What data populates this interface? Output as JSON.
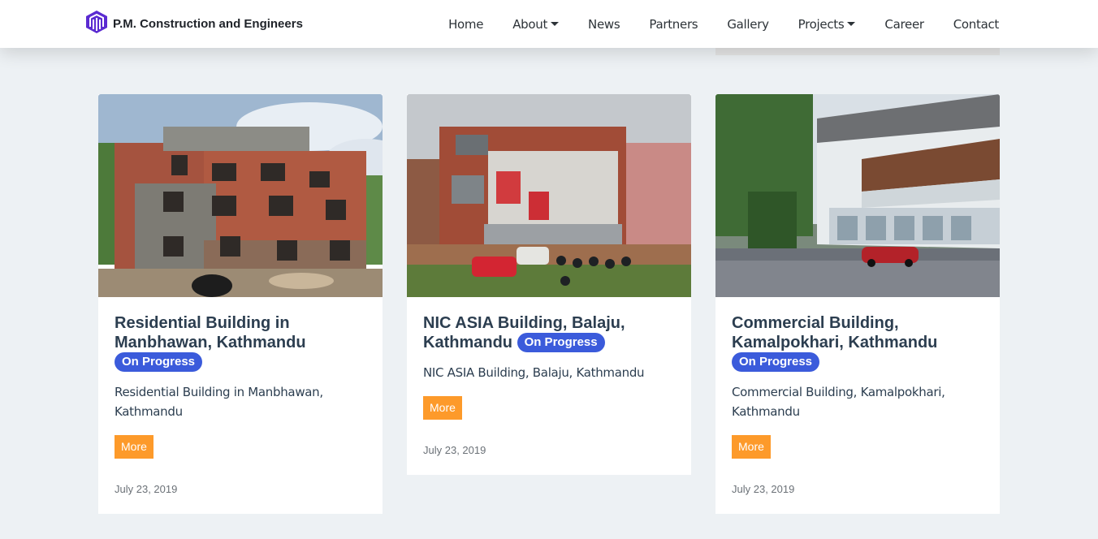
{
  "header": {
    "brand_name": "P.M. Construction and Engineers",
    "nav": [
      {
        "label": "Home",
        "dropdown": false
      },
      {
        "label": "About",
        "dropdown": true
      },
      {
        "label": "News",
        "dropdown": false
      },
      {
        "label": "Partners",
        "dropdown": false
      },
      {
        "label": "Gallery",
        "dropdown": false
      },
      {
        "label": "Projects",
        "dropdown": true
      },
      {
        "label": "Career",
        "dropdown": false
      },
      {
        "label": "Contact",
        "dropdown": false
      }
    ]
  },
  "colors": {
    "accent": "#3b5bdb",
    "button": "#fd9a2a",
    "brand_icon": "#5b2bd1",
    "background": "#edf1f4"
  },
  "projects": [
    {
      "title": "Residential Building in Manbhawan, Kathmandu",
      "status": "On Progress",
      "description": "Residential Building in Manbhawan, Kathmandu",
      "button": "More",
      "date": "July 23, 2019"
    },
    {
      "title": "NIC ASIA Building, Balaju, Kathmandu",
      "status": "On Progress",
      "description": "NIC ASIA Building, Balaju, Kathmandu",
      "button": "More",
      "date": "July 23, 2019"
    },
    {
      "title": "Commercial Building, Kamalpokhari, Kathmandu",
      "status": "On Progress",
      "description": "Commercial Building, Kamalpokhari, Kathmandu",
      "button": "More",
      "date": "July 23, 2019"
    }
  ]
}
